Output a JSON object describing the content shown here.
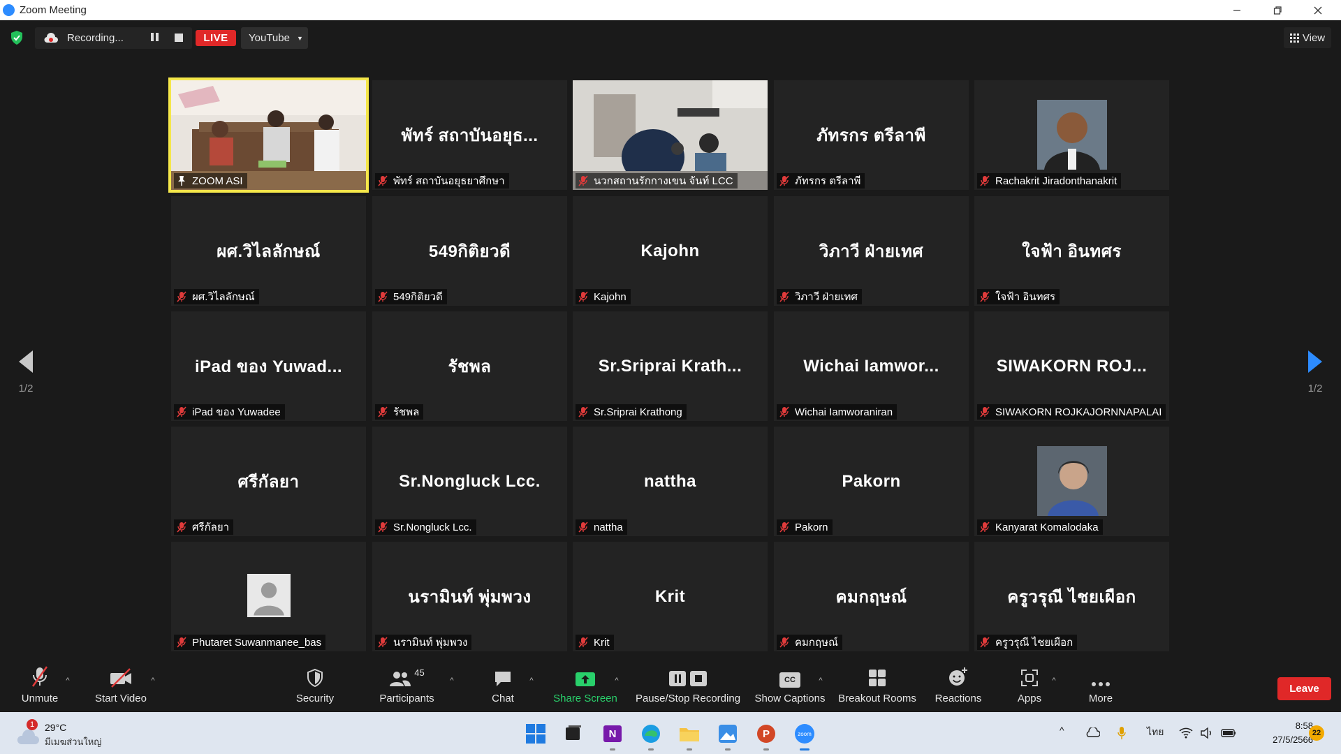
{
  "window": {
    "title": "Zoom Meeting"
  },
  "top": {
    "recording_label": "Recording...",
    "live_label": "LIVE",
    "stream_target": "YouTube",
    "view_label": "View"
  },
  "pagination": {
    "left": "1/2",
    "right": "1/2"
  },
  "tiles": [
    {
      "display": "",
      "label": "ZOOM ASI",
      "type": "video",
      "active": true,
      "pinned": true
    },
    {
      "display": "พัทร์ สถาบันอยุธ...",
      "label": "พัทร์ สถาบันอยุธยาศึกษา",
      "type": "name"
    },
    {
      "display": "",
      "label": "นวกสถานรักกางเขน จันท์ LCC",
      "type": "video"
    },
    {
      "display": "ภัทรกร ตรีลาพี",
      "label": "ภัทรกร ตรีลาพี",
      "type": "name"
    },
    {
      "display": "",
      "label": "Rachakrit Jiradonthanakrit",
      "type": "photo"
    },
    {
      "display": "ผศ.วิไลลักษณ์",
      "label": "ผศ.วิไลลักษณ์",
      "type": "name"
    },
    {
      "display": "549กิติยวดี",
      "label": "549กิติยวดี",
      "type": "name"
    },
    {
      "display": "Kajohn",
      "label": "Kajohn",
      "type": "name"
    },
    {
      "display": "วิภาวี ฝ่ายเทศ",
      "label": "วิภาวี ฝ่ายเทศ",
      "type": "name"
    },
    {
      "display": "ใจฟ้า อินทศร",
      "label": "ใจฟ้า อินทศร",
      "type": "name"
    },
    {
      "display": "iPad ของ Yuwad...",
      "label": "iPad ของ Yuwadee",
      "type": "name"
    },
    {
      "display": "รัชพล",
      "label": "รัชพล",
      "type": "name"
    },
    {
      "display": "Sr.Sriprai Krath...",
      "label": "Sr.Sriprai Krathong",
      "type": "name"
    },
    {
      "display": "Wichai Iamwor...",
      "label": "Wichai Iamworaniran",
      "type": "name"
    },
    {
      "display": "SIWAKORN ROJ...",
      "label": "SIWAKORN ROJKAJORNNAPALAI",
      "type": "name"
    },
    {
      "display": "ศรีกัลยา",
      "label": "ศรีกัลยา",
      "type": "name"
    },
    {
      "display": "Sr.Nongluck Lcc.",
      "label": "Sr.Nongluck Lcc.",
      "type": "name"
    },
    {
      "display": "nattha",
      "label": "nattha",
      "type": "name"
    },
    {
      "display": "Pakorn",
      "label": "Pakorn",
      "type": "name"
    },
    {
      "display": "",
      "label": "Kanyarat Komalodaka",
      "type": "photo2"
    },
    {
      "display": "",
      "label": "Phutaret Suwanmanee_bas",
      "type": "avatar"
    },
    {
      "display": "นรามินท์ พุ่มพวง",
      "label": "นรามินท์ พุ่มพวง",
      "type": "name"
    },
    {
      "display": "Krit",
      "label": "Krit",
      "type": "name"
    },
    {
      "display": "คมกฤษณ์",
      "label": "คมกฤษณ์",
      "type": "name"
    },
    {
      "display": "ครูวรุณี ไชยเผือก",
      "label": "ครูวรุณี ไชยเผือก",
      "type": "name"
    }
  ],
  "toolbar": {
    "unmute": "Unmute",
    "start_video": "Start Video",
    "security": "Security",
    "participants": "Participants",
    "participants_count": "45",
    "chat": "Chat",
    "share_screen": "Share Screen",
    "pause_stop_recording": "Pause/Stop Recording",
    "show_captions": "Show Captions",
    "breakout_rooms": "Breakout Rooms",
    "reactions": "Reactions",
    "apps": "Apps",
    "more": "More",
    "leave": "Leave",
    "cc_icon_text": "CC"
  },
  "taskbar": {
    "weather_temp": "29°C",
    "weather_cond": "มีเมฆส่วนใหญ่",
    "weather_badge": "1",
    "language": "ไทย",
    "time": "8:58",
    "date": "27/5/2566",
    "notification_count": "22",
    "zoom_icon_text": "zoom",
    "onenote_letter": "N",
    "powerpoint_letter": "P"
  },
  "colors": {
    "live_red": "#e02828",
    "active_speaker": "#f5e74a",
    "share_green": "#29d06b",
    "muted_red": "#e03b3b",
    "zoom_blue": "#2d8cff"
  }
}
